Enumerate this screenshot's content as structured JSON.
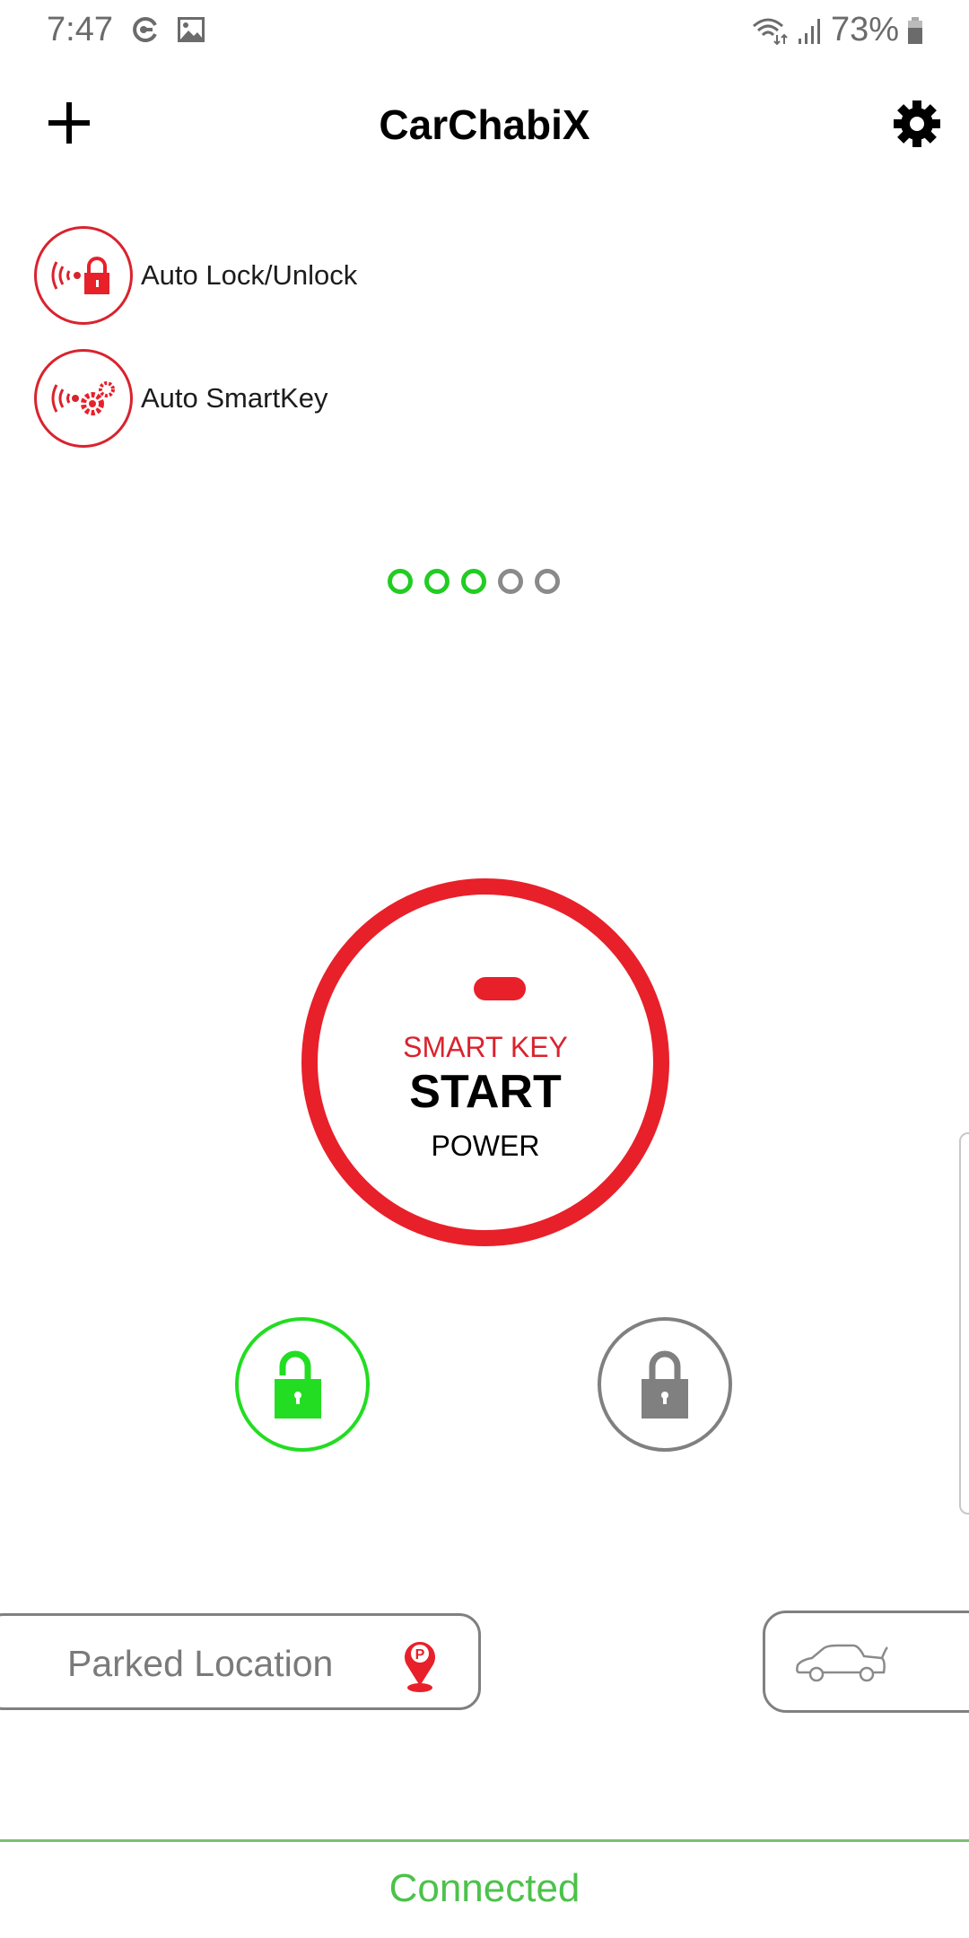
{
  "status_bar": {
    "time": "7:47",
    "left_icons": [
      "sync-icon",
      "image-icon"
    ],
    "right_icons": [
      "wifi-icon",
      "signal-icon",
      "battery-icon"
    ],
    "battery": "73%"
  },
  "header": {
    "title": "CarChabiX",
    "add_icon": "plus-icon",
    "settings_icon": "gear-icon"
  },
  "features": [
    {
      "label": "Auto Lock/Unlock",
      "icon": "auto-lock-icon"
    },
    {
      "label": "Auto SmartKey",
      "icon": "auto-smartkey-icon"
    }
  ],
  "page_indicator": {
    "total": 5,
    "active": 3
  },
  "start_button": {
    "line1": "SMART KEY",
    "line2": "START",
    "line3": "POWER"
  },
  "lock_controls": {
    "unlock": {
      "icon": "unlock-icon",
      "state": "active"
    },
    "lock": {
      "icon": "lock-icon",
      "state": "inactive"
    }
  },
  "parked_location": {
    "label": "Parked Location",
    "icon": "parking-pin-icon"
  },
  "trunk_button": {
    "icon": "car-trunk-icon"
  },
  "connection": {
    "status": "Connected"
  },
  "colors": {
    "brand_red": "#e8202a",
    "active_green": "#22dd22",
    "connected_green": "#4cc24a",
    "inactive_gray": "#808080"
  }
}
